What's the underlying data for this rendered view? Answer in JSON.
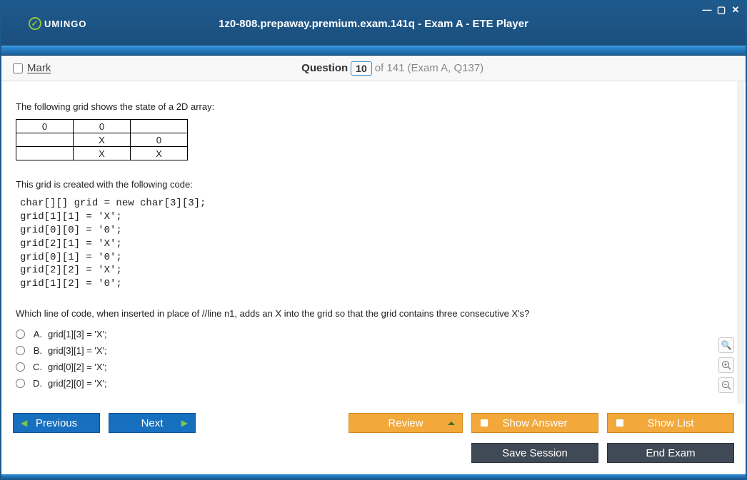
{
  "window": {
    "title": "1z0-808.prepaway.premium.exam.141q - Exam A - ETE Player",
    "brand": "UMINGO"
  },
  "header": {
    "mark_label": "Mark",
    "question_label": "Question",
    "question_num": "10",
    "of_total": "of 141",
    "context": "(Exam A, Q137)"
  },
  "question": {
    "intro": "The following grid shows the state of a 2D array:",
    "grid": [
      [
        "0",
        "0",
        ""
      ],
      [
        "",
        "X",
        "0"
      ],
      [
        "",
        "X",
        "X"
      ]
    ],
    "created_with": "This grid is created with the following code:",
    "code": "char[][] grid = new char[3][3];\ngrid[1][1] = 'X';\ngrid[0][0] = '0';\ngrid[2][1] = 'X';\ngrid[0][1] = '0';\ngrid[2][2] = 'X';\ngrid[1][2] = '0';",
    "prompt": "Which line of code, when inserted in place of //line n1, adds an X into the grid so that the grid contains three consecutive X's?",
    "answers": [
      {
        "letter": "A.",
        "text": "grid[1][3] = 'X';"
      },
      {
        "letter": "B.",
        "text": "grid[3][1] = 'X';"
      },
      {
        "letter": "C.",
        "text": "grid[0][2] = 'X';"
      },
      {
        "letter": "D.",
        "text": "grid[2][0] = 'X';"
      }
    ]
  },
  "buttons": {
    "prev": "Previous",
    "next": "Next",
    "review": "Review",
    "show_answer": "Show Answer",
    "show_list": "Show List",
    "save_session": "Save Session",
    "end_exam": "End Exam"
  },
  "tools": {
    "search": "🔍",
    "zoom_in": "🔍+",
    "zoom_out": "🔍−"
  }
}
